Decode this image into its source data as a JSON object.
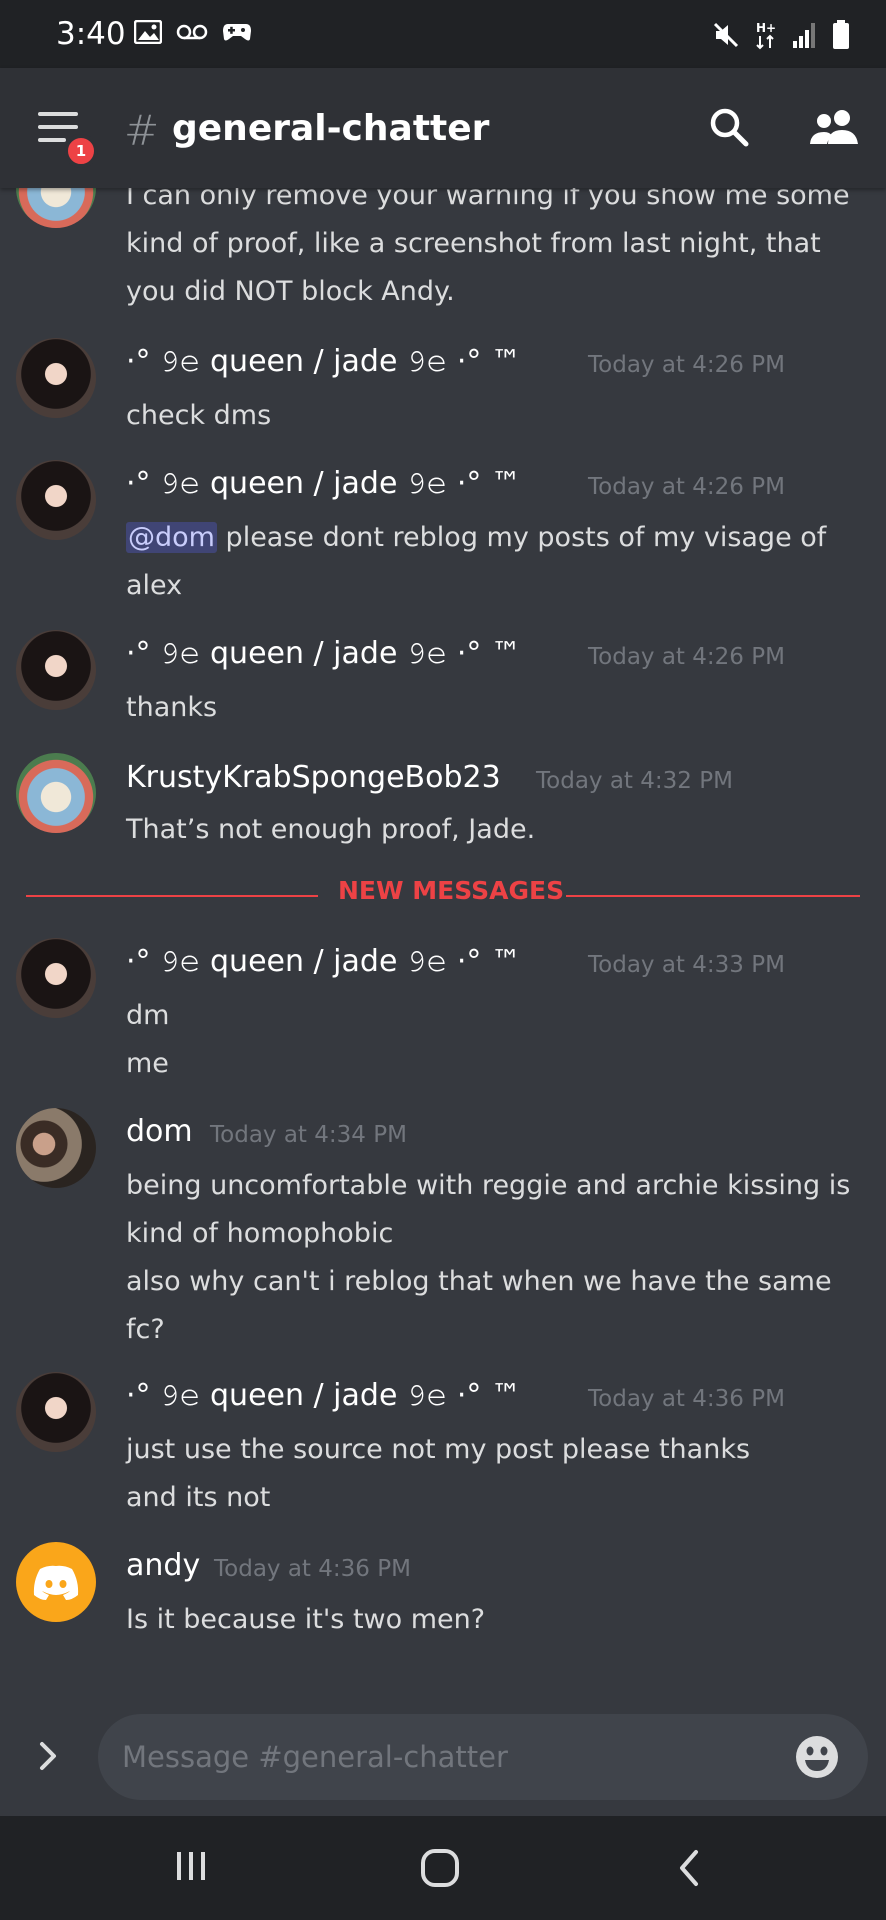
{
  "status_bar": {
    "time": "3:40",
    "icons_left": [
      "image-icon",
      "voicemail-icon",
      "game-controller-icon"
    ],
    "icons_right": [
      "mute-icon",
      "network-h-plus-icon",
      "signal-icon",
      "battery-icon"
    ]
  },
  "header": {
    "hash": "#",
    "channel": "general-chatter",
    "badge": "1",
    "icons": [
      "hamburger-menu-icon",
      "search-icon",
      "members-icon"
    ]
  },
  "messages": [
    {
      "lines": [
        "I can only remove your warning if you show me some",
        "kind of proof, like a screenshot from last night, that",
        "you did NOT block Andy."
      ]
    },
    {
      "author": "·° 𝟿𝚎 queen / jade 𝟿𝚎 ·° ™",
      "time": "Today at 4:26 PM",
      "lines": [
        "check dms"
      ]
    },
    {
      "author": "·° 𝟿𝚎 queen / jade 𝟿𝚎 ·° ™",
      "time": "Today at 4:26 PM",
      "mention": "@dom",
      "lines": [
        " please dont reblog my posts of my visage of",
        "alex"
      ]
    },
    {
      "author": "·° 𝟿𝚎 queen / jade 𝟿𝚎 ·° ™",
      "time": "Today at 4:26 PM",
      "lines": [
        "thanks"
      ]
    },
    {
      "author": "KrustyKrabSpongeBob23",
      "time": "Today at 4:32 PM",
      "lines": [
        "That’s not enough proof, Jade."
      ]
    },
    {
      "author": "·° 𝟿𝚎 queen / jade 𝟿𝚎 ·° ™",
      "time": "Today at 4:33 PM",
      "lines": [
        "dm",
        "me"
      ]
    },
    {
      "author": "dom",
      "time": "Today at 4:34 PM",
      "lines": [
        "being uncomfortable with reggie and archie kissing is",
        "kind of homophobic",
        "also why can't i reblog that when we have the same",
        "fc?"
      ]
    },
    {
      "author": "·° 𝟿𝚎 queen / jade 𝟿𝚎 ·° ™",
      "time": "Today at 4:36 PM",
      "lines": [
        "just use the source not my post please thanks",
        "and its not"
      ]
    },
    {
      "author": "andy",
      "time": "Today at 4:36 PM",
      "lines": [
        "Is it because it's two men?"
      ]
    }
  ],
  "divider": {
    "label": "NEW MESSAGES"
  },
  "composer": {
    "placeholder": "Message #general-chatter"
  },
  "nav_bar": {
    "icons": [
      "recent-apps-icon",
      "home-icon",
      "back-icon"
    ]
  },
  "colors": {
    "background": "#36393f",
    "header": "#2f3136",
    "status_bar": "#202225",
    "new_messages": "#ed4245",
    "andy_avatar": "#faa61a",
    "mention_text": "#c9cdfb"
  }
}
